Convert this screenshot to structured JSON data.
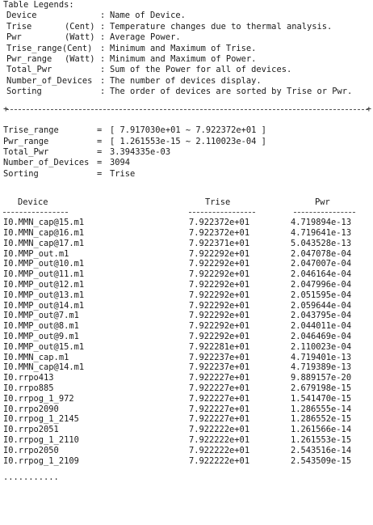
{
  "legend": {
    "title": "Table Legends:",
    "items": [
      {
        "key": "Device",
        "unit": "",
        "desc": "Name of Device."
      },
      {
        "key": "Trise",
        "unit": "(Cent)",
        "desc": "Temperature changes due to thermal analysis."
      },
      {
        "key": "Pwr",
        "unit": "(Watt)",
        "desc": "Average Power."
      },
      {
        "key": "Trise_range(Cent)",
        "unit": "",
        "desc": "Minimum and Maximum of Trise."
      },
      {
        "key": "Pwr_range",
        "unit": "(Watt)",
        "desc": "Minimum and Maximum of Power."
      },
      {
        "key": "Total_Pwr",
        "unit": "",
        "desc": "Sum of the Power for all of devices."
      },
      {
        "key": "Number_of_Devices",
        "unit": "",
        "desc": "The number of devices display."
      },
      {
        "key": "Sorting",
        "unit": "",
        "desc": "The order of devices are sorted by Trise or Pwr."
      }
    ]
  },
  "separator": {
    "left": "+",
    "right": "+"
  },
  "summary": [
    {
      "key": "Trise_range",
      "value": "[ 7.917030e+01 ~ 7.922372e+01 ]"
    },
    {
      "key": "Pwr_range",
      "value": "[ 1.261553e-15 ~ 2.110023e-04 ]"
    },
    {
      "key": "Total_Pwr",
      "value": "3.394335e-03"
    },
    {
      "key": "Number_of_Devices",
      "value": "3094"
    },
    {
      "key": "Sorting",
      "value": "Trise"
    }
  ],
  "table": {
    "headers": {
      "device": "Device",
      "trise": "Trise",
      "pwr": "Pwr"
    },
    "rows": [
      {
        "device": "I0.MMN_cap@15.m1",
        "trise": "7.922372e+01",
        "pwr": "4.719894e-13"
      },
      {
        "device": "I0.MMN_cap@16.m1",
        "trise": "7.922372e+01",
        "pwr": "4.719641e-13"
      },
      {
        "device": "I0.MMN_cap@17.m1",
        "trise": "7.922371e+01",
        "pwr": "5.043528e-13"
      },
      {
        "device": "I0.MMP_out.m1",
        "trise": "7.922292e+01",
        "pwr": "2.047078e-04"
      },
      {
        "device": "I0.MMP_out@10.m1",
        "trise": "7.922292e+01",
        "pwr": "2.047007e-04"
      },
      {
        "device": "I0.MMP_out@11.m1",
        "trise": "7.922292e+01",
        "pwr": "2.046164e-04"
      },
      {
        "device": "I0.MMP_out@12.m1",
        "trise": "7.922292e+01",
        "pwr": "2.047996e-04"
      },
      {
        "device": "I0.MMP_out@13.m1",
        "trise": "7.922292e+01",
        "pwr": "2.051595e-04"
      },
      {
        "device": "I0.MMP_out@14.m1",
        "trise": "7.922292e+01",
        "pwr": "2.059644e-04"
      },
      {
        "device": "I0.MMP_out@7.m1",
        "trise": "7.922292e+01",
        "pwr": "2.043795e-04"
      },
      {
        "device": "I0.MMP_out@8.m1",
        "trise": "7.922292e+01",
        "pwr": "2.044011e-04"
      },
      {
        "device": "I0.MMP_out@9.m1",
        "trise": "7.922292e+01",
        "pwr": "2.046469e-04"
      },
      {
        "device": "I0.MMP_out@15.m1",
        "trise": "7.922281e+01",
        "pwr": "2.110023e-04"
      },
      {
        "device": "I0.MMN_cap.m1",
        "trise": "7.922237e+01",
        "pwr": "4.719401e-13"
      },
      {
        "device": "I0.MMN_cap@14.m1",
        "trise": "7.922237e+01",
        "pwr": "4.719389e-13"
      },
      {
        "device": "I0.rrpo413",
        "trise": "7.922227e+01",
        "pwr": "9.889157e-20"
      },
      {
        "device": "I0.rrpo885",
        "trise": "7.922227e+01",
        "pwr": "2.679198e-15"
      },
      {
        "device": "I0.rrpog_1_972",
        "trise": "7.922227e+01",
        "pwr": "1.541470e-15"
      },
      {
        "device": "I0.rrpo2090",
        "trise": "7.922227e+01",
        "pwr": "1.286555e-14"
      },
      {
        "device": "I0.rrpog_1_2145",
        "trise": "7.922227e+01",
        "pwr": "1.286552e-15"
      },
      {
        "device": "I0.rrpo2051",
        "trise": "7.922222e+01",
        "pwr": "1.261566e-14"
      },
      {
        "device": "I0.rrpog_1_2110",
        "trise": "7.922222e+01",
        "pwr": "1.261553e-15"
      },
      {
        "device": "I0.rrpo2050",
        "trise": "7.922222e+01",
        "pwr": "2.543516e-14"
      },
      {
        "device": "I0.rrpog_1_2109",
        "trise": "7.922222e+01",
        "pwr": "2.543509e-15"
      }
    ]
  },
  "footer": {
    "ellipsis": "..........."
  }
}
